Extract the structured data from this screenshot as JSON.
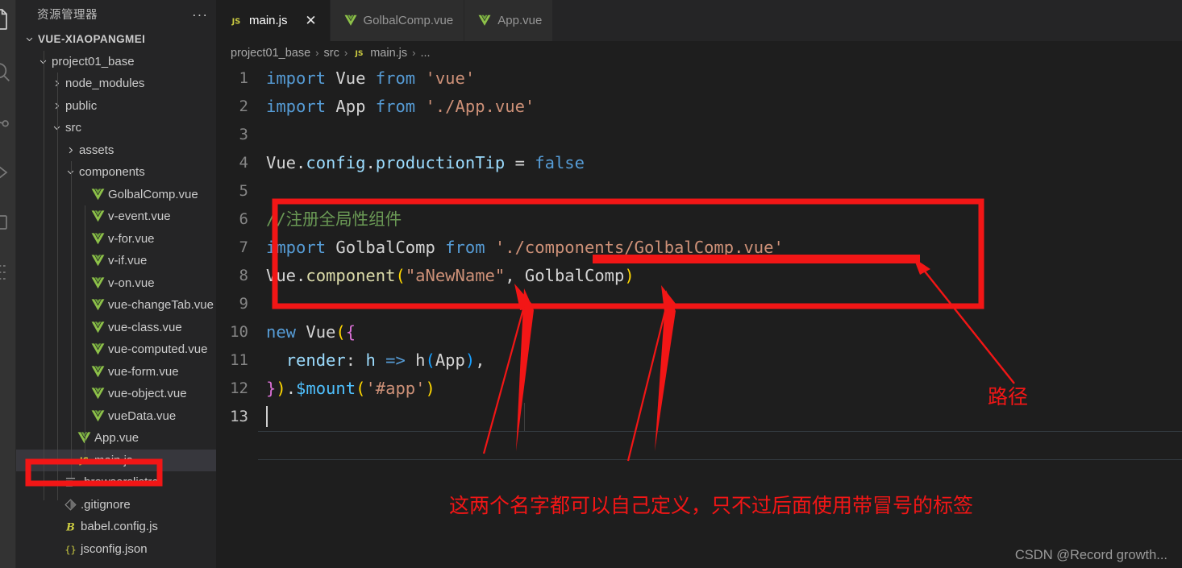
{
  "window": {
    "theme_bg": "#1e1e1e",
    "accent_red": "#f21616",
    "sidebar_bg": "#252526"
  },
  "activity_bar": {
    "items": [
      {
        "name": "explorer-icon",
        "active": true
      },
      {
        "name": "search-icon",
        "active": false
      },
      {
        "name": "source-control-icon",
        "active": false
      },
      {
        "name": "run-debug-icon",
        "active": false
      },
      {
        "name": "extensions-icon",
        "active": false
      },
      {
        "name": "remote-explorer-icon",
        "active": false
      }
    ]
  },
  "sidebar": {
    "title": "资源管理器",
    "more_actions": "···",
    "tree": [
      {
        "label": "VUE-XIAOPANGMEI",
        "indent": 0,
        "type": "root",
        "state": "expanded",
        "icon": "none"
      },
      {
        "label": "project01_base",
        "indent": 1,
        "type": "folder",
        "state": "expanded",
        "icon": "none"
      },
      {
        "label": "node_modules",
        "indent": 2,
        "type": "folder",
        "state": "collapsed",
        "icon": "none"
      },
      {
        "label": "public",
        "indent": 2,
        "type": "folder",
        "state": "collapsed",
        "icon": "none"
      },
      {
        "label": "src",
        "indent": 2,
        "type": "folder",
        "state": "expanded",
        "icon": "none"
      },
      {
        "label": "assets",
        "indent": 3,
        "type": "folder",
        "state": "collapsed",
        "icon": "none"
      },
      {
        "label": "components",
        "indent": 3,
        "type": "folder",
        "state": "expanded",
        "icon": "none"
      },
      {
        "label": "GolbalComp.vue",
        "indent": 4,
        "type": "file",
        "state": "none",
        "icon": "vue-icon"
      },
      {
        "label": "v-event.vue",
        "indent": 4,
        "type": "file",
        "state": "none",
        "icon": "vue-icon"
      },
      {
        "label": "v-for.vue",
        "indent": 4,
        "type": "file",
        "state": "none",
        "icon": "vue-icon"
      },
      {
        "label": "v-if.vue",
        "indent": 4,
        "type": "file",
        "state": "none",
        "icon": "vue-icon"
      },
      {
        "label": "v-on.vue",
        "indent": 4,
        "type": "file",
        "state": "none",
        "icon": "vue-icon"
      },
      {
        "label": "vue-changeTab.vue",
        "indent": 4,
        "type": "file",
        "state": "none",
        "icon": "vue-icon"
      },
      {
        "label": "vue-class.vue",
        "indent": 4,
        "type": "file",
        "state": "none",
        "icon": "vue-icon"
      },
      {
        "label": "vue-computed.vue",
        "indent": 4,
        "type": "file",
        "state": "none",
        "icon": "vue-icon"
      },
      {
        "label": "vue-form.vue",
        "indent": 4,
        "type": "file",
        "state": "none",
        "icon": "vue-icon"
      },
      {
        "label": "vue-object.vue",
        "indent": 4,
        "type": "file",
        "state": "none",
        "icon": "vue-icon"
      },
      {
        "label": "vueData.vue",
        "indent": 4,
        "type": "file",
        "state": "none",
        "icon": "vue-icon"
      },
      {
        "label": "App.vue",
        "indent": 3,
        "type": "file",
        "state": "none",
        "icon": "vue-icon"
      },
      {
        "label": "main.js",
        "indent": 3,
        "type": "file",
        "state": "selected",
        "icon": "js-icon"
      },
      {
        "label": ".browserslistrc",
        "indent": 2,
        "type": "file",
        "state": "none",
        "icon": "config-icon"
      },
      {
        "label": ".gitignore",
        "indent": 2,
        "type": "file",
        "state": "none",
        "icon": "git-icon"
      },
      {
        "label": "babel.config.js",
        "indent": 2,
        "type": "file",
        "state": "none",
        "icon": "babel-icon"
      },
      {
        "label": "jsconfig.json",
        "indent": 2,
        "type": "file",
        "state": "none",
        "icon": "json-icon"
      }
    ]
  },
  "tabs": [
    {
      "label": "main.js",
      "icon": "js-icon",
      "active": true,
      "close": "✕"
    },
    {
      "label": "GolbalComp.vue",
      "icon": "vue-icon",
      "active": false,
      "close": ""
    },
    {
      "label": "App.vue",
      "icon": "vue-icon",
      "active": false,
      "close": ""
    }
  ],
  "breadcrumb": {
    "parts": [
      "project01_base",
      "src",
      "main.js",
      "..."
    ],
    "separator": "›",
    "file_icon": "js-icon"
  },
  "code": {
    "lines": [
      {
        "no": "1",
        "text": "import Vue from 'vue'"
      },
      {
        "no": "2",
        "text": "import App from './App.vue'"
      },
      {
        "no": "3",
        "text": ""
      },
      {
        "no": "4",
        "text": "Vue.config.productionTip = false"
      },
      {
        "no": "5",
        "text": ""
      },
      {
        "no": "6",
        "text": "//注册全局性组件"
      },
      {
        "no": "7",
        "text": "import GolbalComp from './components/GolbalComp.vue'"
      },
      {
        "no": "8",
        "text": "Vue.component(\"aNewName\", GolbalComp)"
      },
      {
        "no": "9",
        "text": ""
      },
      {
        "no": "10",
        "text": "new Vue({"
      },
      {
        "no": "11",
        "text": "  render: h => h(App),"
      },
      {
        "no": "12",
        "text": "}).$mount('#app')"
      },
      {
        "no": "13",
        "text": ""
      }
    ],
    "current_line": "13"
  },
  "annotations": {
    "path_label": "路径",
    "bottom_note": "这两个名字都可以自己定义，只不过后面使用带冒号的标签",
    "color": "#f21616"
  },
  "watermark": "CSDN @Record growth..."
}
